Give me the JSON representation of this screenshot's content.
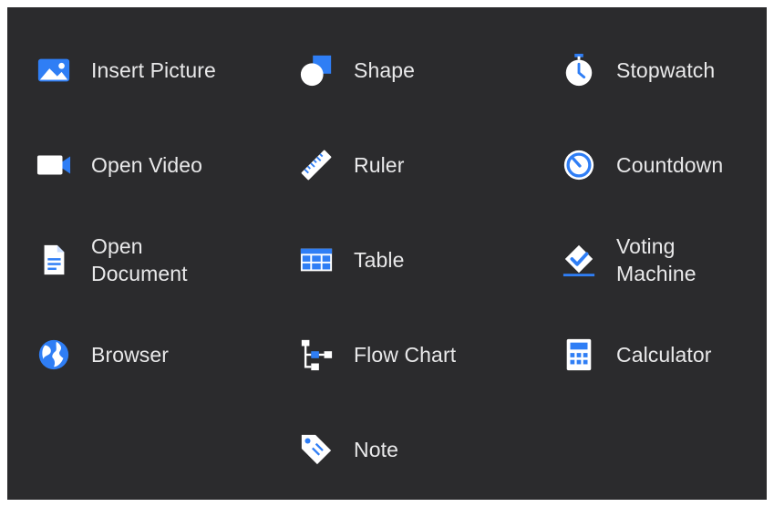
{
  "colors": {
    "panel_background": "#2b2b2d",
    "icon_blue": "#2f7ef5",
    "icon_white": "#ffffff",
    "text": "#e9e9ea"
  },
  "tools": {
    "column1": [
      {
        "label": "Insert Picture",
        "icon": "image-icon"
      },
      {
        "label": "Open Video",
        "icon": "video-camera-icon"
      },
      {
        "label": "Open Document",
        "icon": "document-icon"
      },
      {
        "label": "Browser",
        "icon": "globe-icon"
      }
    ],
    "column2": [
      {
        "label": "Shape",
        "icon": "shape-icon"
      },
      {
        "label": "Ruler",
        "icon": "ruler-icon"
      },
      {
        "label": "Table",
        "icon": "table-icon"
      },
      {
        "label": "Flow Chart",
        "icon": "flow-chart-icon"
      },
      {
        "label": "Note",
        "icon": "tag-note-icon"
      }
    ],
    "column3": [
      {
        "label": "Stopwatch",
        "icon": "stopwatch-icon"
      },
      {
        "label": "Countdown",
        "icon": "countdown-timer-icon"
      },
      {
        "label": "Voting Machine",
        "icon": "voting-check-icon"
      },
      {
        "label": "Calculator",
        "icon": "calculator-icon"
      }
    ]
  }
}
